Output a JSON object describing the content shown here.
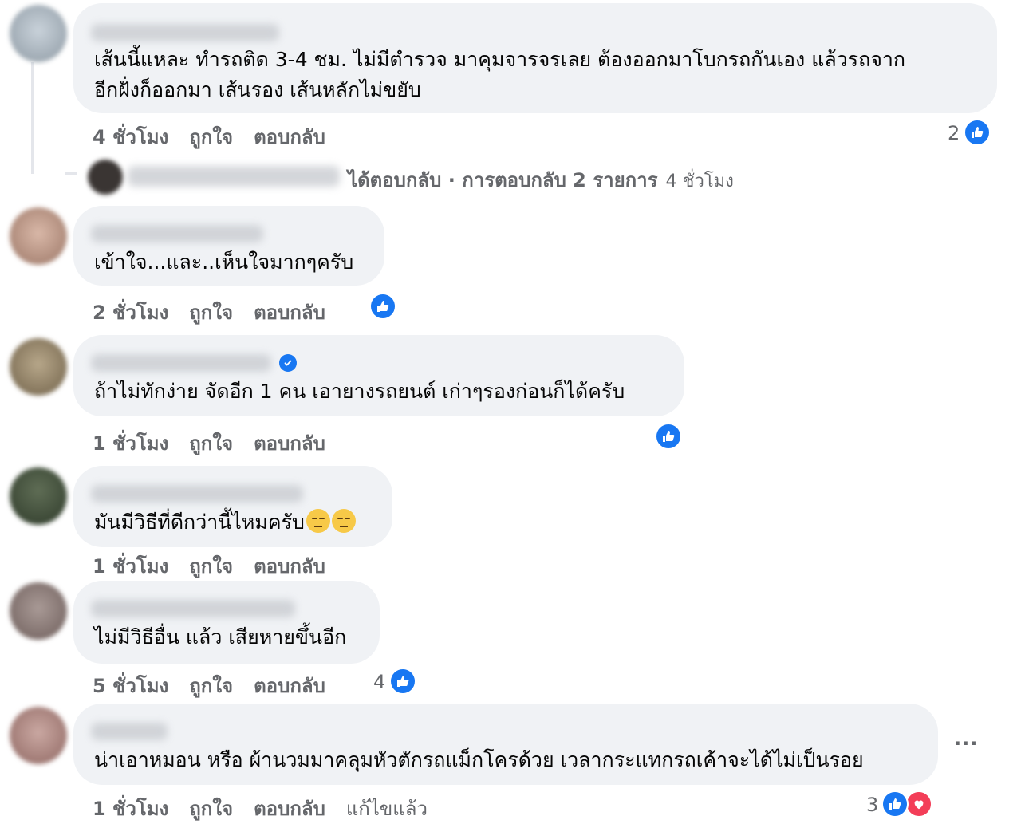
{
  "comments": [
    {
      "text_lines": [
        "เส้นนี้แหละ ทำรถติด 3-4 ชม. ไม่มีตำรวจ มาคุมจารจรเลย ต้องออกมาโบกรถกันเอง แล้วรถจาก",
        "อีกฝั่งก็ออกมา เส้นรอง เส้นหลักไม่ขยับ"
      ],
      "time": "4 ชั่วโมง",
      "like": "ถูกใจ",
      "reply": "ตอบกลับ",
      "reaction_count": "2"
    },
    {
      "text_lines": [
        "เข้าใจ...และ..เห็นใจมากๆครับ"
      ],
      "time": "2 ชั่วโมง",
      "like": "ถูกใจ",
      "reply": "ตอบกลับ",
      "reaction_count": ""
    },
    {
      "text_lines": [
        "ถ้าไม่ทักง่าย จัดอีก 1 คน เอายางรถยนต์ เก่าๆรองก่อนก็ได้ครับ"
      ],
      "time": "1 ชั่วโมง",
      "like": "ถูกใจ",
      "reply": "ตอบกลับ",
      "reaction_count": ""
    },
    {
      "text_lines": [
        "มันมีวิธีที่ดีกว่านี้ไหมครับ"
      ],
      "time": "1 ชั่วโมง",
      "like": "ถูกใจ",
      "reply": "ตอบกลับ",
      "reaction_count": ""
    },
    {
      "text_lines": [
        "ไม่มีวิธีอื่น แล้ว เสียหายขึ้นอีก"
      ],
      "time": "5 ชั่วโมง",
      "like": "ถูกใจ",
      "reply": "ตอบกลับ",
      "reaction_count": "4"
    },
    {
      "text_lines": [
        "น่าเอาหมอน หรือ ผ้านวมมาคลุมหัวตักรถแม็กโครด้วย เวลากระแทกรถเค้าจะได้ไม่เป็นรอย"
      ],
      "time": "1 ชั่วโมง",
      "like": "ถูกใจ",
      "reply": "ตอบกลับ",
      "edited": "แก้ไขแล้ว",
      "reaction_count": "3"
    }
  ],
  "replies_summary": {
    "text": "ได้ตอบกลับ · การตอบกลับ 2 รายการ",
    "time": "4 ชั่วโมง"
  },
  "more_options": "···",
  "colors": {
    "bubble": "#f0f2f5",
    "meta_text": "#65676b",
    "like_blue": "#1877f2",
    "love_red": "#f33e58"
  },
  "icons": [
    "like-icon",
    "love-icon",
    "verified-badge-icon",
    "unamused-emoji-icon",
    "more-options-icon"
  ]
}
